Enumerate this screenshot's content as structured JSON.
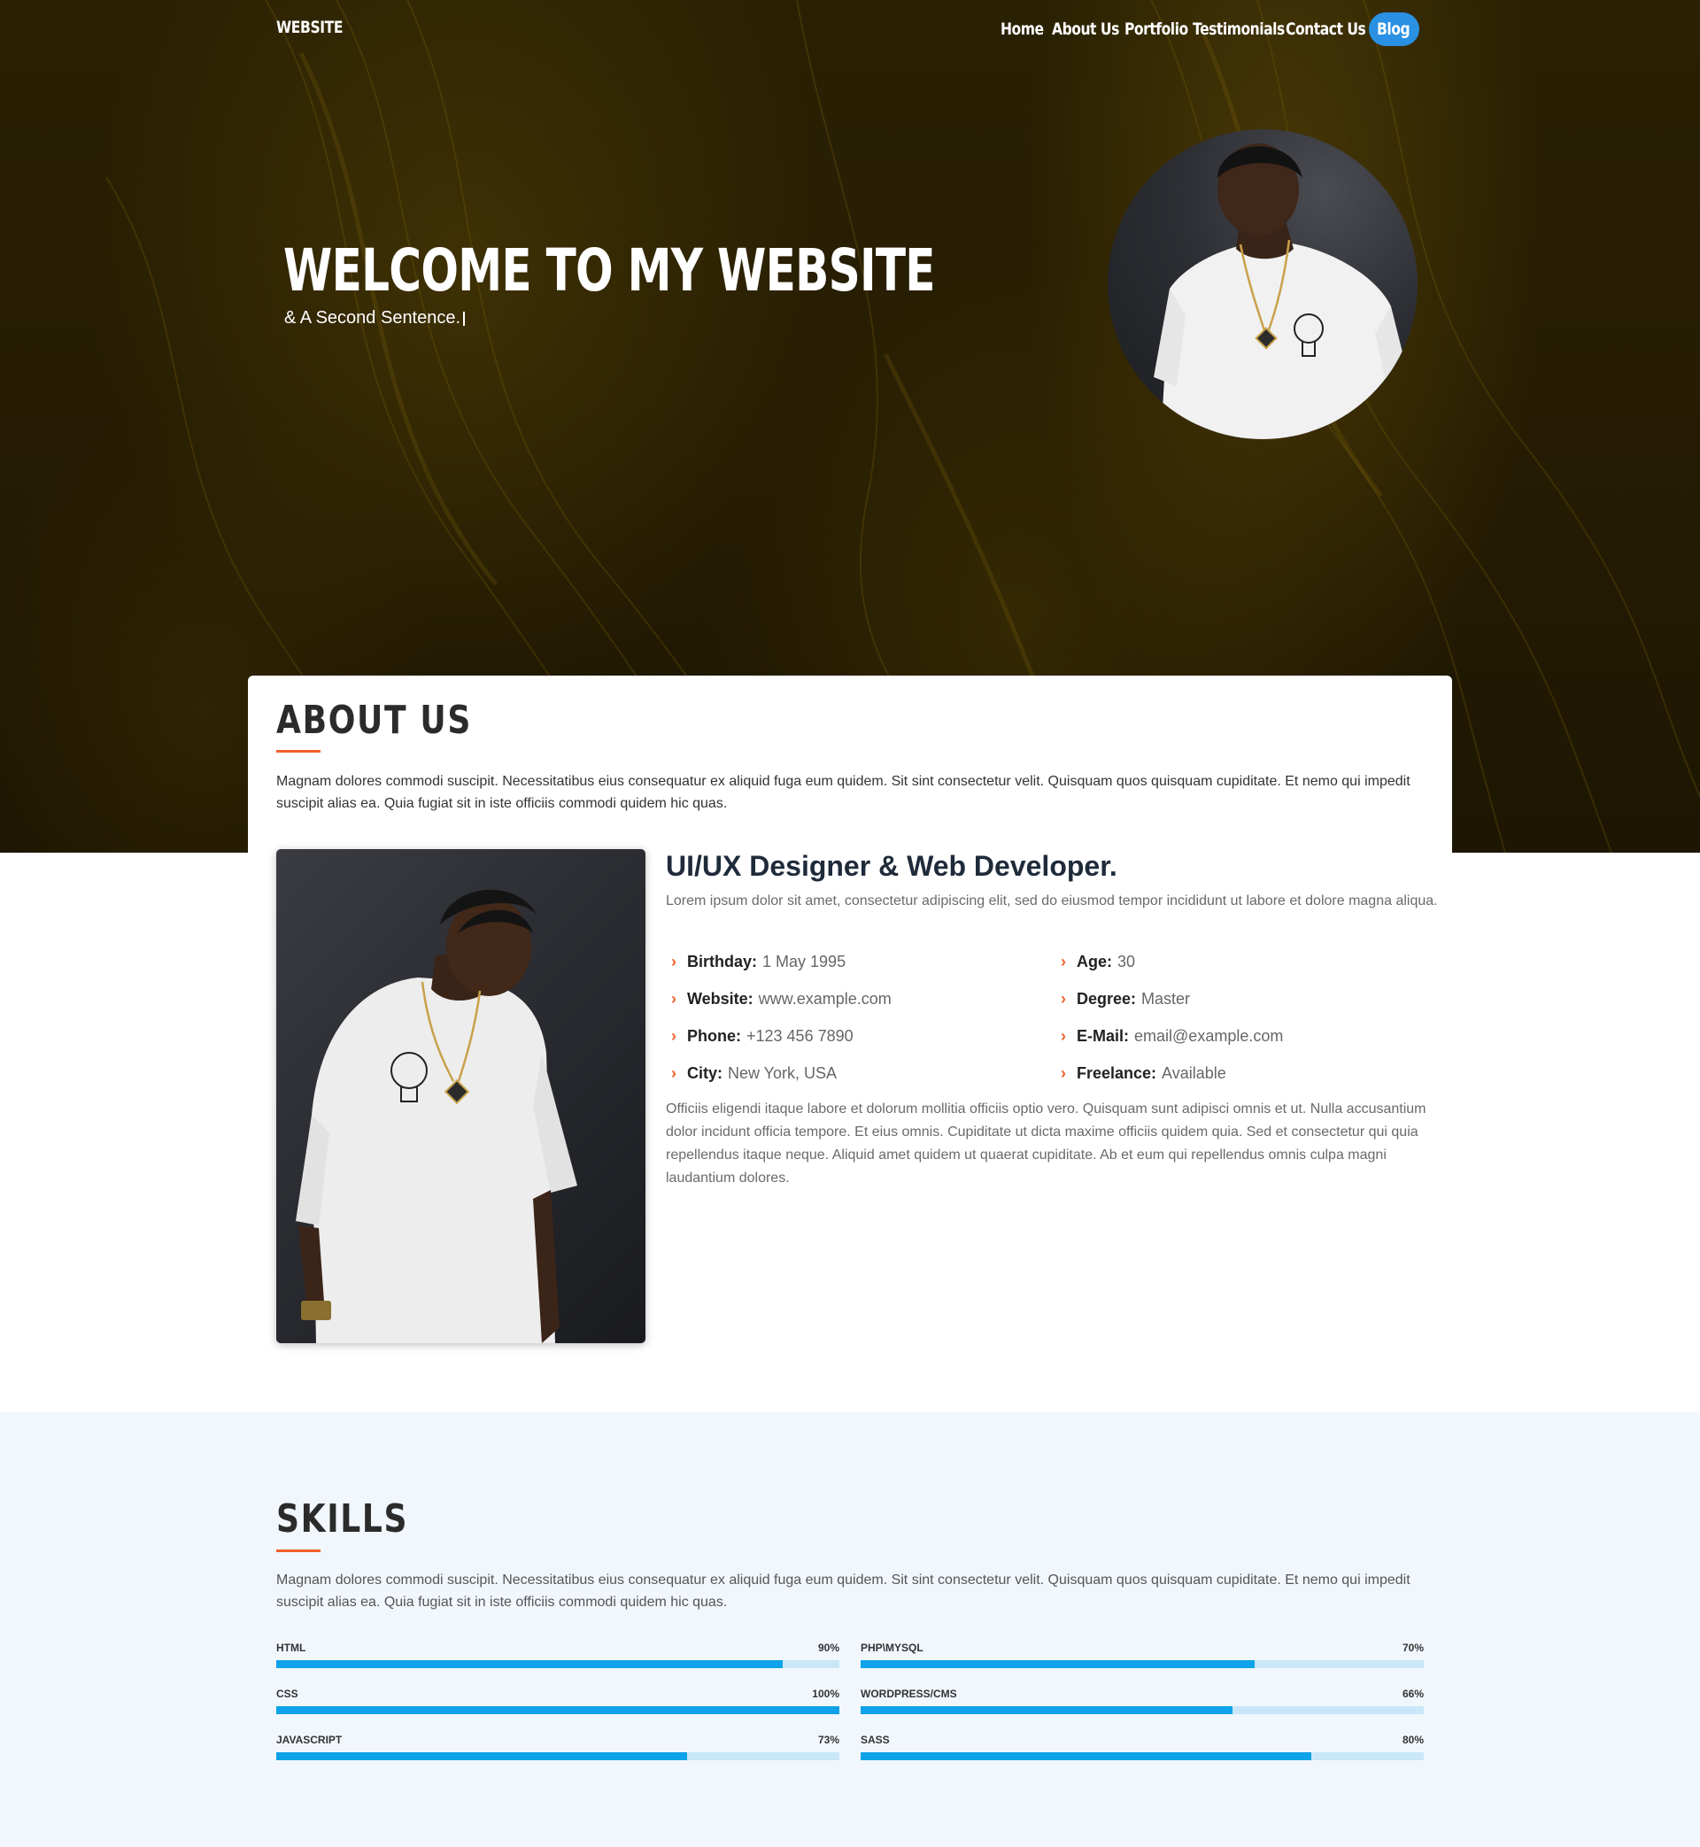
{
  "navbar": {
    "logo": "WEBSITE",
    "items": [
      {
        "label": "Home"
      },
      {
        "label": "About Us"
      },
      {
        "label": "Portfolio"
      },
      {
        "label": "Testimonials"
      },
      {
        "label": "Contact Us"
      }
    ],
    "blog_label": "Blog",
    "blog_color": "#2a90e3"
  },
  "hero": {
    "title": "WELCOME TO MY WEBSITE",
    "subtitle": "& A Second Sentence."
  },
  "about": {
    "title": "ABOUT US",
    "description": "Magnam dolores commodi suscipit. Necessitatibus eius consequatur ex aliquid fuga eum quidem. Sit sint consectetur velit. Quisquam quos quisquam cupiditate. Et nemo qui impedit suscipit alias ea. Quia fugiat sit in iste officiis commodi quidem hic quas.",
    "heading": "UI/UX Designer & Web Developer.",
    "lead": "Lorem ipsum dolor sit amet, consectetur adipiscing elit, sed do eiusmod tempor incididunt ut labore et dolore magna aliqua.",
    "info_left": [
      {
        "label": "Birthday:",
        "value": "1 May 1995"
      },
      {
        "label": "Website:",
        "value": "www.example.com"
      },
      {
        "label": "Phone:",
        "value": "+123 456 7890"
      },
      {
        "label": "City:",
        "value": "New York, USA"
      }
    ],
    "info_right": [
      {
        "label": "Age:",
        "value": "30"
      },
      {
        "label": "Degree:",
        "value": "Master"
      },
      {
        "label": "E-Mail:",
        "value": "email@example.com"
      },
      {
        "label": "Freelance:",
        "value": "Available"
      }
    ],
    "body": "Officiis eligendi itaque labore et dolorum mollitia officiis optio vero. Quisquam sunt adipisci omnis et ut. Nulla accusantium dolor incidunt officia tempore. Et eius omnis. Cupiditate ut dicta maxime officiis quidem quia. Sed et consectetur qui quia repellendus itaque neque. Aliquid amet quidem ut quaerat cupiditate. Ab et eum qui repellendus omnis culpa magni laudantium dolores.",
    "accent_color": "#f0602a"
  },
  "skills": {
    "title": "SKILLS",
    "description": "Magnam dolores commodi suscipit. Necessitatibus eius consequatur ex aliquid fuga eum quidem. Sit sint consectetur velit. Quisquam quos quisquam cupiditate. Et nemo qui impedit suscipit alias ea. Quia fugiat sit in iste officiis commodi quidem hic quas.",
    "bar_color": "#0ea2e8",
    "items": [
      {
        "name": "HTML",
        "percent": "90%",
        "value": 90
      },
      {
        "name": "PHP\\MYSQL",
        "percent": "70%",
        "value": 70
      },
      {
        "name": "CSS",
        "percent": "100%",
        "value": 100
      },
      {
        "name": "WORDPRESS/CMS",
        "percent": "66%",
        "value": 66
      },
      {
        "name": "JAVASCRIPT",
        "percent": "73%",
        "value": 73
      },
      {
        "name": "SASS",
        "percent": "80%",
        "value": 80
      }
    ]
  }
}
